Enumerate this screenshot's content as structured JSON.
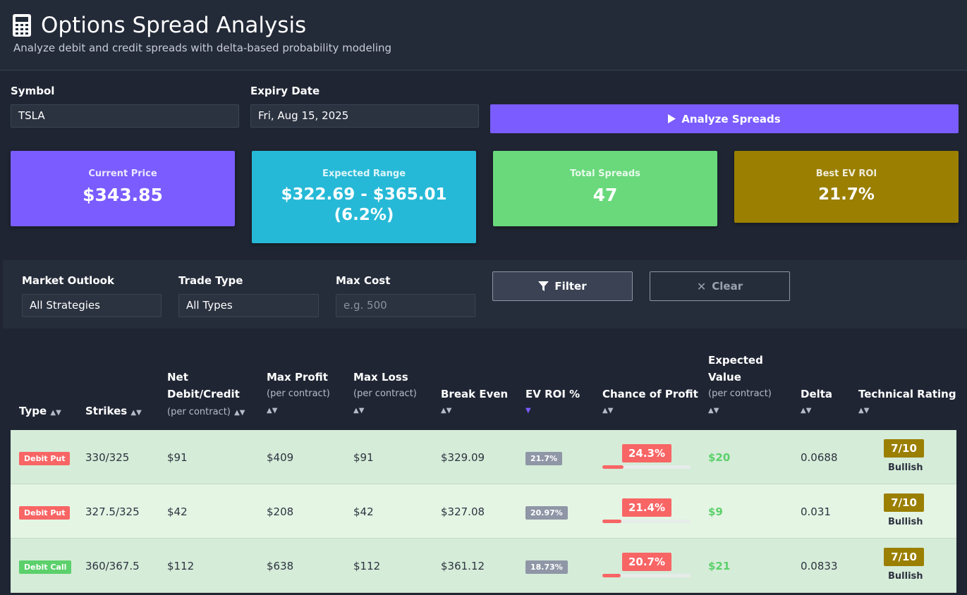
{
  "header": {
    "title": "Options Spread Analysis",
    "subtitle": "Analyze debit and credit spreads with delta-based probability modeling",
    "icon": "calculator-icon"
  },
  "form": {
    "symbol_label": "Symbol",
    "symbol_value": "TSLA",
    "expiry_label": "Expiry Date",
    "expiry_value": "Fri, Aug 15, 2025",
    "analyze_label": "Analyze Spreads"
  },
  "stats": [
    {
      "label": "Current Price",
      "value": "$343.85",
      "color": "#7a5cff"
    },
    {
      "label": "Expected Range",
      "value": "$322.69 - $365.01 (6.2%)",
      "color": "#26b9d7"
    },
    {
      "label": "Total Spreads",
      "value": "47",
      "color": "#69d97c"
    },
    {
      "label": "Best EV ROI",
      "value": "21.7%",
      "color": "#9a7f00"
    }
  ],
  "filters": {
    "outlook_label": "Market Outlook",
    "outlook_value": "All Strategies",
    "trade_type_label": "Trade Type",
    "trade_type_value": "All Types",
    "max_cost_label": "Max Cost",
    "max_cost_placeholder": "e.g. 500",
    "filter_label": "Filter",
    "clear_label": "Clear"
  },
  "table": {
    "columns": [
      {
        "label": "Type"
      },
      {
        "label": "Strikes"
      },
      {
        "label": "Net",
        "label2": "Debit/Credit",
        "sub": "(per contract)"
      },
      {
        "label": "Max Profit",
        "sub": "(per contract)"
      },
      {
        "label": "Max Loss",
        "sub": "(per contract)"
      },
      {
        "label": "Break Even"
      },
      {
        "label": "EV ROI %"
      },
      {
        "label": "Chance of Profit"
      },
      {
        "label": "Expected",
        "label2": "Value",
        "sub": "(per contract)"
      },
      {
        "label": "Delta"
      },
      {
        "label": "Technical Rating"
      }
    ],
    "sorted_column": "EV ROI %",
    "rows": [
      {
        "type": "Debit Put",
        "type_color": "#f86565",
        "strikes": "330/325",
        "net": "$91",
        "max_profit": "$409",
        "max_loss": "$91",
        "break_even": "$329.09",
        "ev_roi": "21.7%",
        "chance": "24.3%",
        "chance_value": 0.243,
        "ev": "$20",
        "delta": "0.0688",
        "rating": "7/10",
        "rating_label": "Bullish",
        "bg": "#d5ecd8"
      },
      {
        "type": "Debit Put",
        "type_color": "#f86565",
        "strikes": "327.5/325",
        "net": "$42",
        "max_profit": "$208",
        "max_loss": "$42",
        "break_even": "$327.08",
        "ev_roi": "20.97%",
        "chance": "21.4%",
        "chance_value": 0.214,
        "ev": "$9",
        "delta": "0.031",
        "rating": "7/10",
        "rating_label": "Bullish",
        "bg": "#e4f5e4"
      },
      {
        "type": "Debit Call",
        "type_color": "#5bd06b",
        "strikes": "360/367.5",
        "net": "$112",
        "max_profit": "$638",
        "max_loss": "$112",
        "break_even": "$361.12",
        "ev_roi": "18.73%",
        "chance": "20.7%",
        "chance_value": 0.207,
        "ev": "$21",
        "delta": "0.0833",
        "rating": "7/10",
        "rating_label": "Bullish",
        "bg": "#d5ecd8"
      }
    ]
  }
}
